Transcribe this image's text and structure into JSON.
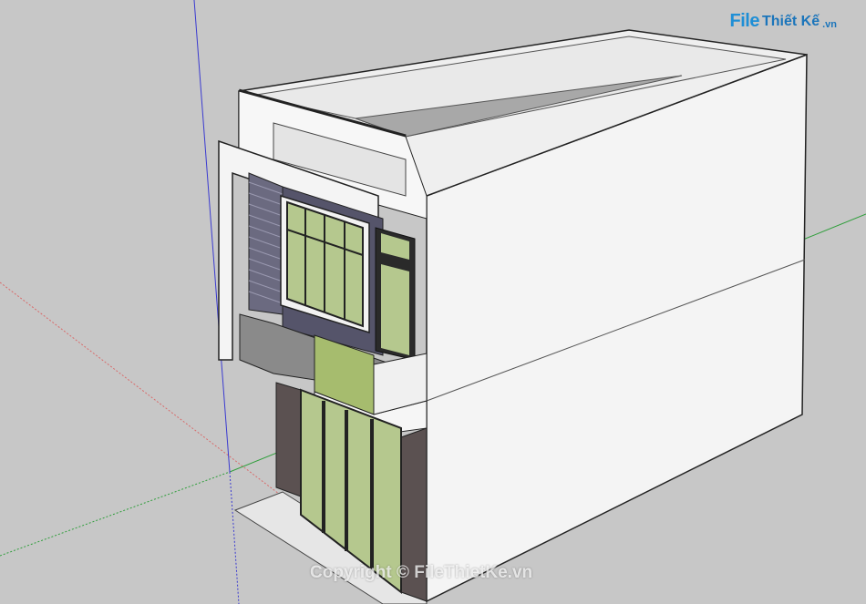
{
  "watermark": {
    "text": "Copyright © FileThietKe.vn"
  },
  "logo": {
    "file": "File",
    "rest": "Thiết Kế",
    "tld": ".vn"
  },
  "colors": {
    "background": "#c7c7c7",
    "wall": "#f2f2f2",
    "glass": "#b5c88e",
    "frame": "#2a2a2a",
    "stone": "#5b5151",
    "panel": "#6b6a80"
  }
}
